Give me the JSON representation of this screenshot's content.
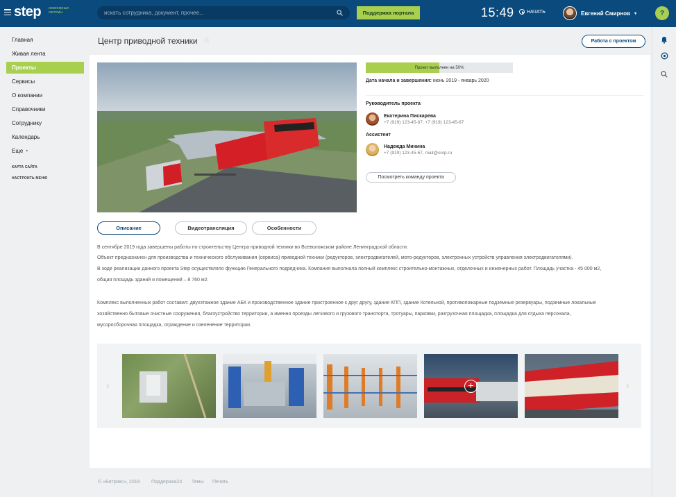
{
  "topbar": {
    "logo": "step",
    "logo_tag": "инженерные системы",
    "search_placeholder": "искать сотрудника, документ, прочее...",
    "support_label": "Поддержка портала",
    "clock": "15:49",
    "start_label": "НАЧАТЬ",
    "user_name": "Евгений Смирнов",
    "help_label": "?"
  },
  "sidebar": {
    "items": [
      {
        "label": "Главная"
      },
      {
        "label": "Живая лента"
      },
      {
        "label": "Проекты",
        "active": true
      },
      {
        "label": "Сервисы"
      },
      {
        "label": "О компании"
      },
      {
        "label": "Справочники"
      },
      {
        "label": "Сотруднику"
      },
      {
        "label": "Календарь"
      },
      {
        "label": "Еще"
      }
    ],
    "sitemap_label": "КАРТА САЙТА",
    "configure_label": "НАСТРОИТЬ МЕНЮ"
  },
  "header": {
    "title": "Центр приводной техники",
    "work_button": "Работа с проектом"
  },
  "project": {
    "progress_percent": 50,
    "progress_label": "Проект выполнен на 50%",
    "dates_label": "Дата начала и завершения:",
    "dates_value": "июнь 2019 - январь 2020",
    "manager_label": "Руководитель проекта",
    "manager_name": "Екатерина Пискарева",
    "manager_contact": "+7 (919) 123-45-67, +7 (919) 123-45-67",
    "assistant_label": "Ассистент",
    "assistant_name": "Надежда Минина",
    "assistant_contact": "+7 (919) 123-45-67, mail@corp.ru",
    "team_button": "Посмотреть команду проекта"
  },
  "tabs": [
    {
      "label": "Описание",
      "active": true
    },
    {
      "label": "Видеотрансляция"
    },
    {
      "label": "Особенности"
    }
  ],
  "description": {
    "p1": "В сентябре 2019 года завершены работы по строительству Центра приводной техники во Всеволожском районе Ленинградской области.",
    "p2": "Объект предназначен для производства и технического обслуживания (сервиса) приводной техники (редукторов, электродвигателей, мото-редукторов, электронных устройств управления электродвигателями).",
    "p3a": "В ходе реализации данного проекта Step осуществляло функцию Генерального подрядчика. Компания выполнила полный комплекс строительно-монтажных, отделочных и инженерных работ. Площадь участка - 45 000 м2,",
    "p3b": "общая площадь зданий и помещений – 8 760 м2.",
    "p4a": "Комплекс выполненных работ составил: двухэтажное здание АБК и производственное здание пристроенное к друг другу, здание КПП, здание Котельной, противопожарные подземные резервуары, подземные локальные",
    "p4b": "хозяйственно бытовые очистные сооружения, благоустройство территории, а именно проезды легкового и грузового транспорта, тротуары, парковки, разгрузочная площадка, площадка для отдыха персонала,",
    "p4c": "мусоросборочная площадка, ограждение и озеленение территории."
  },
  "footer": {
    "copyright": "© «Битрикс», 2019",
    "support": "Поддержка24",
    "themes": "Темы",
    "print": "Печать"
  },
  "colors": {
    "brand_blue": "#0b4a7d",
    "accent_green": "#a9cf4f"
  }
}
